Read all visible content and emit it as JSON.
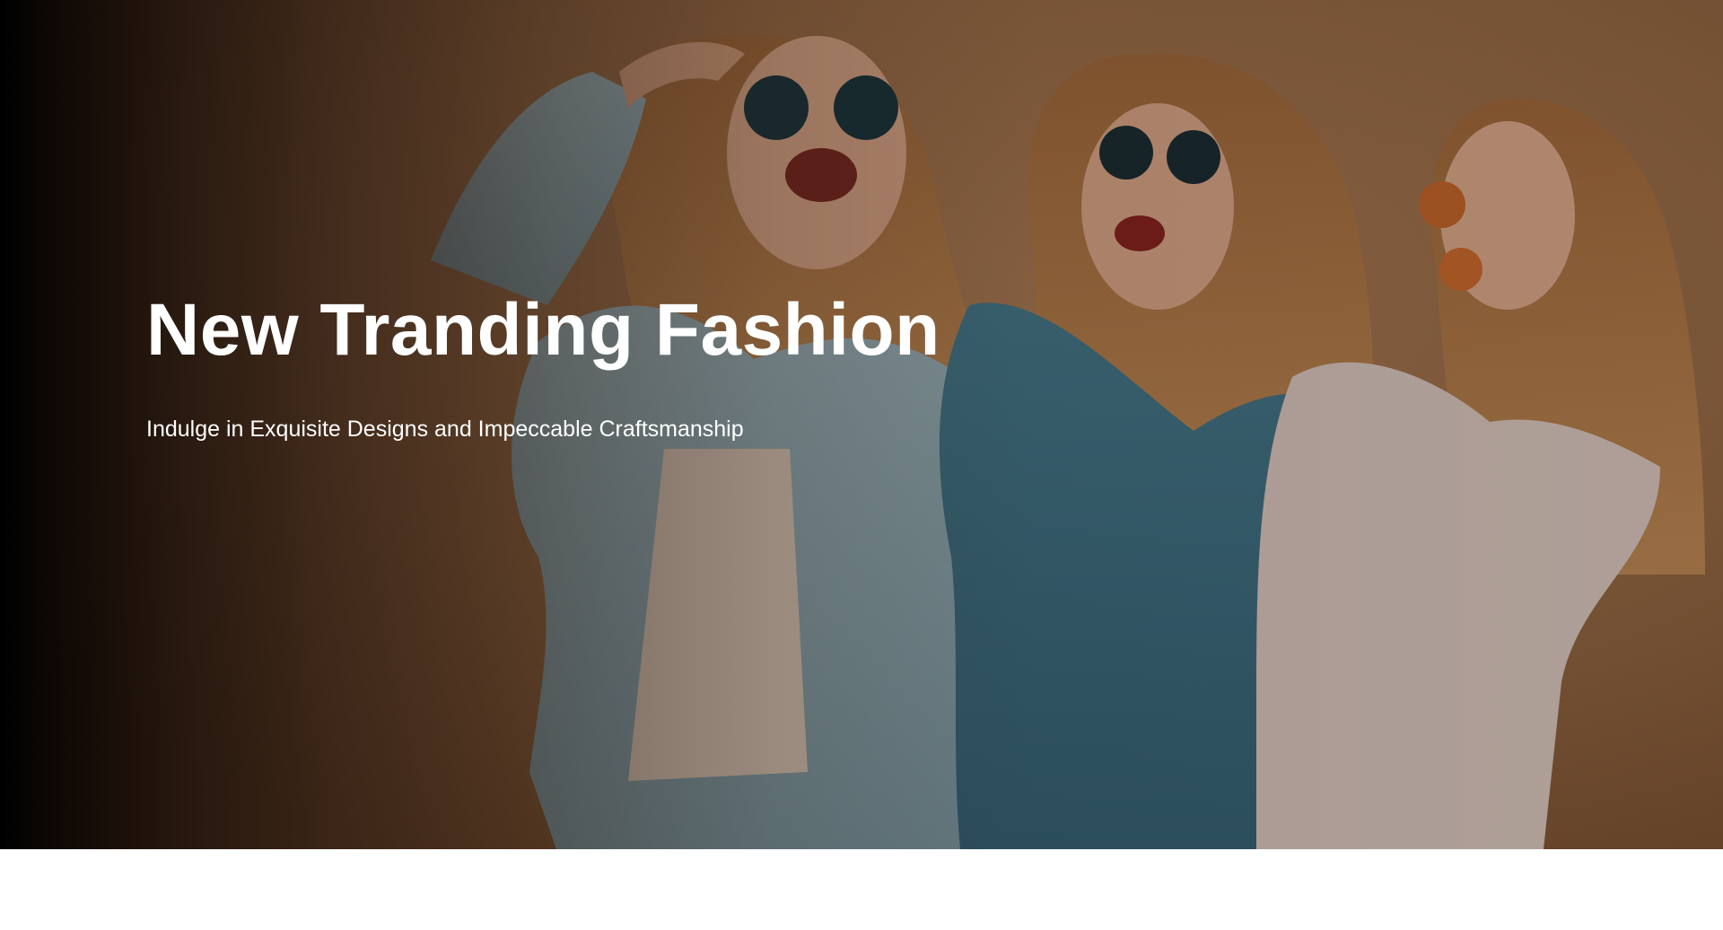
{
  "hero": {
    "title": "New Tranding Fashion",
    "subtitle": "Indulge in Exquisite Designs and Impeccable Craftsmanship",
    "background_image": "three-women-sunglasses-photo",
    "colors": {
      "backdrop": "#8a6140",
      "text": "#ffffff",
      "overlay_dark": "#000000"
    }
  }
}
